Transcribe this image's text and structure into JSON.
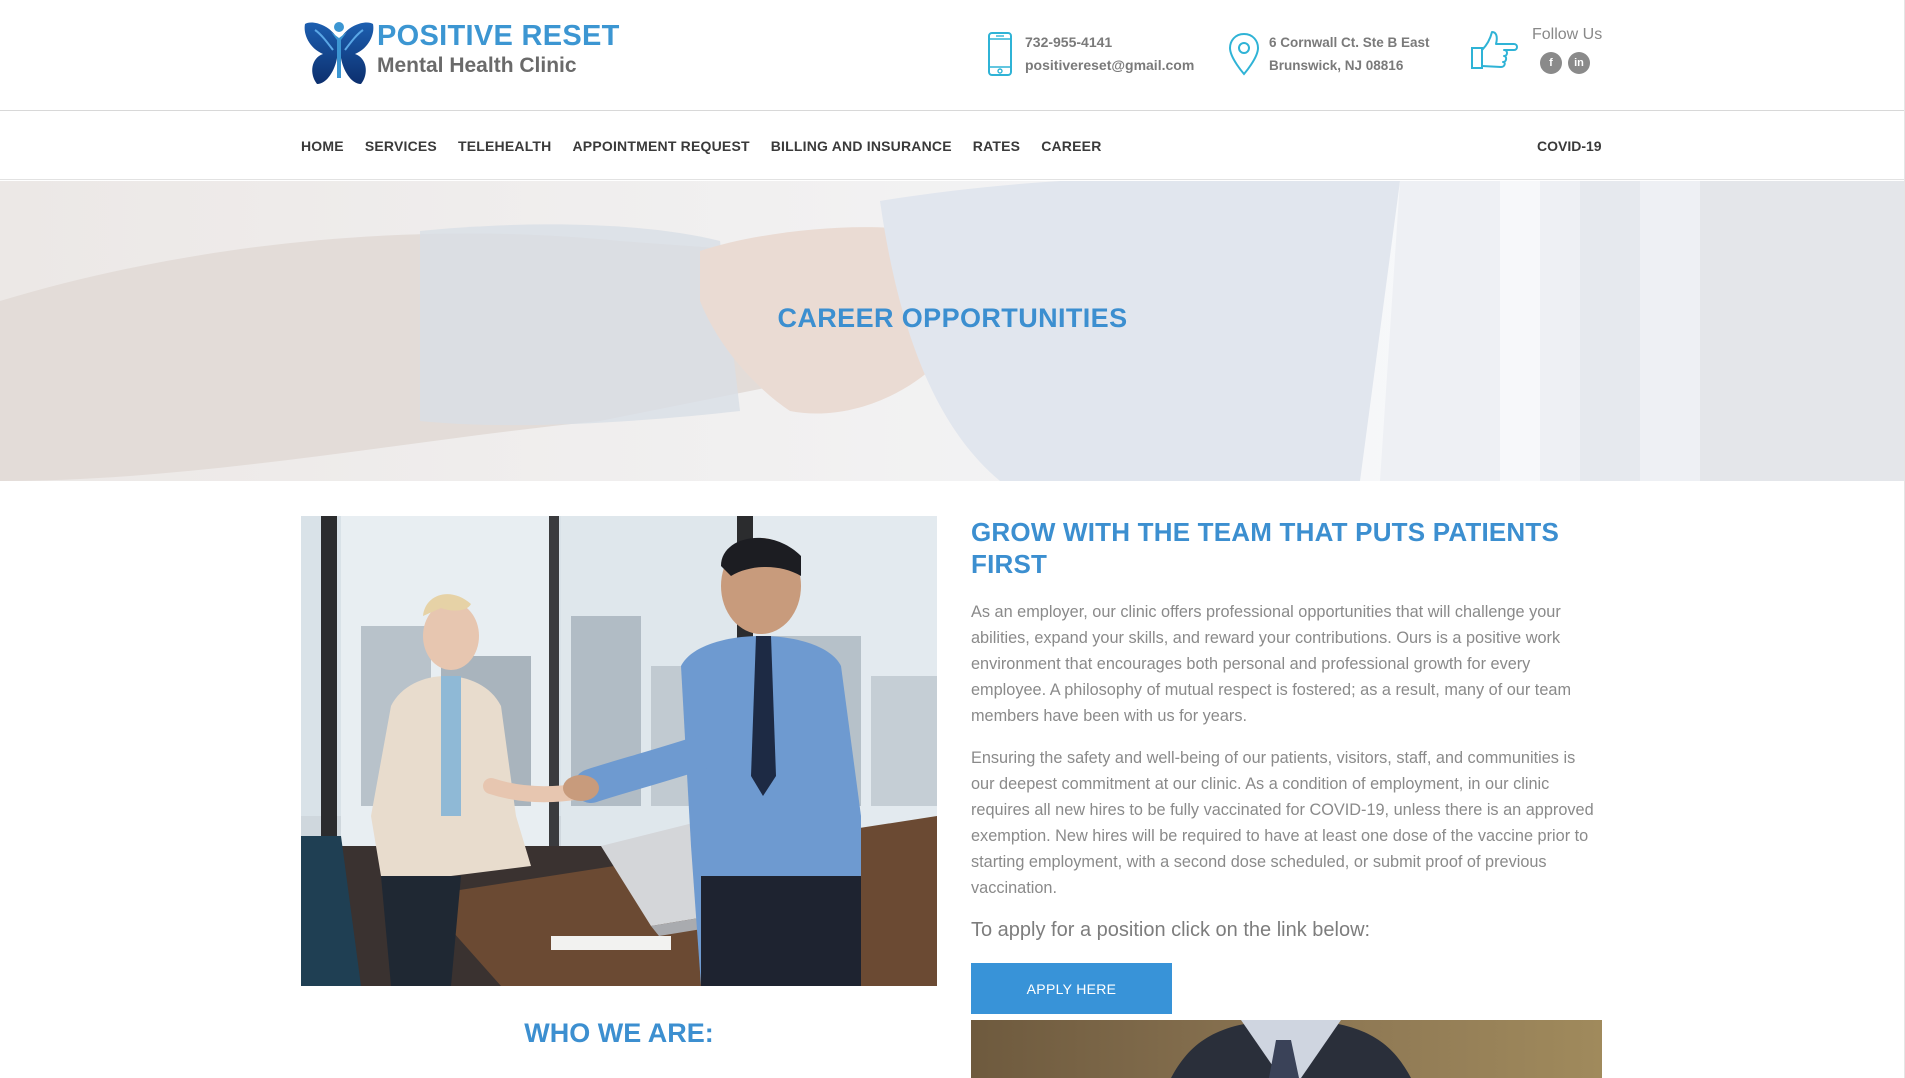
{
  "brand": {
    "title": "POSITIVE RESET",
    "subtitle": "Mental Health Clinic"
  },
  "contact": {
    "phone": "732-955-4141",
    "email": "positivereset@gmail.com",
    "address_line1": "6 Cornwall Ct. Ste B East",
    "address_line2": "Brunswick, NJ 08816",
    "follow_label": "Follow Us",
    "social_facebook": "f",
    "social_linkedin": "in"
  },
  "nav": {
    "items": [
      "HOME",
      "SERVICES",
      "TELEHEALTH",
      "APPOINTMENT REQUEST",
      "BILLING AND INSURANCE",
      "RATES",
      "CAREER"
    ],
    "right": "COVID-19"
  },
  "hero": {
    "title": "CAREER OPPORTUNITIES"
  },
  "main": {
    "heading": "GROW WITH THE TEAM THAT PUTS PATIENTS FIRST",
    "para1": "As an employer, our clinic offers professional opportunities that will challenge your abilities, expand your skills, and reward your contributions. Ours is a positive work environment that encourages both personal and professional growth for every employee. A philosophy of mutual respect is fostered; as a result, many of our team members have been with us for years.",
    "para2": "Ensuring the safety and well-being of our patients, visitors, staff, and communities is our deepest commitment at our clinic. As a condition of employment, in our clinic requires all new hires to be fully vaccinated for COVID-19, unless there is an approved exemption. New hires will be required to have at least one dose of the vaccine prior to starting employment, with a second dose scheduled, or submit proof of previous vaccination.",
    "apply_text": "To apply for a position click on the link below:",
    "apply_button": "APPLY HERE",
    "who_heading": "WHO WE ARE:"
  },
  "colors": {
    "accent": "#3c8fd0",
    "button": "#3893d8",
    "nav_text": "#3a3a3a",
    "body_text": "#8a8a8a"
  },
  "icons": [
    "butterfly-logo-icon",
    "phone-icon",
    "location-pin-icon",
    "pointing-hand-icon",
    "facebook-icon",
    "linkedin-icon"
  ]
}
